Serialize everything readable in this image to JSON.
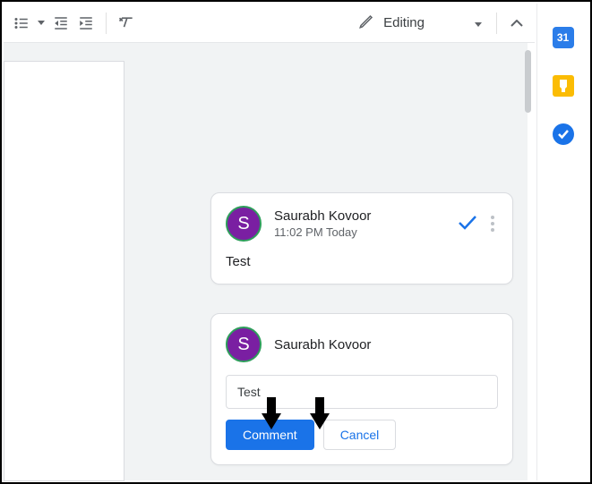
{
  "toolbar": {
    "mode_label": "Editing"
  },
  "side_panel": {
    "calendar_day": "31"
  },
  "comment_thread": {
    "avatar_initial": "S",
    "author": "Saurabh Kovoor",
    "timestamp": "11:02 PM Today",
    "body": "Test"
  },
  "reply_box": {
    "avatar_initial": "S",
    "author": "Saurabh Kovoor",
    "input_value": "Test",
    "submit_label": "Comment",
    "cancel_label": "Cancel"
  }
}
